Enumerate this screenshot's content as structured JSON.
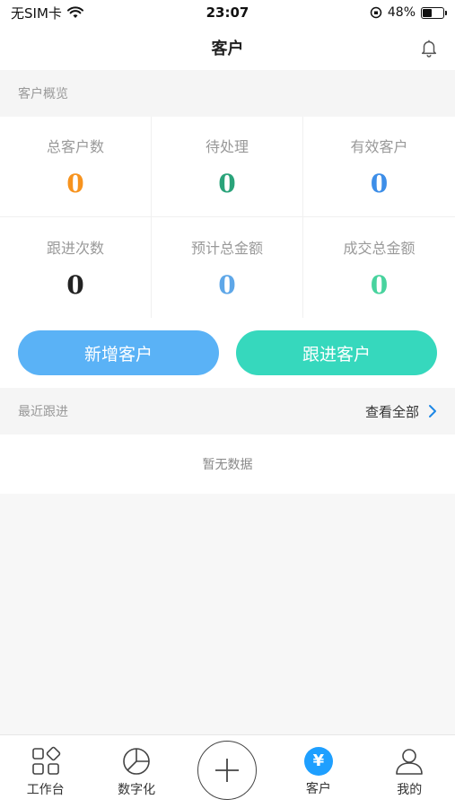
{
  "status": {
    "carrier": "无SIM卡",
    "time": "23:07",
    "battery_percent": "48%",
    "battery_level": 0.48
  },
  "nav": {
    "title": "客户",
    "bell_icon": "bell-icon"
  },
  "overview": {
    "title": "客户概览"
  },
  "stats": [
    {
      "label": "总客户数",
      "value": "0",
      "color": "#f7931e"
    },
    {
      "label": "待处理",
      "value": "0",
      "color": "#2aa37a"
    },
    {
      "label": "有效客户",
      "value": "0",
      "color": "#3d8ee8"
    },
    {
      "label": "跟进次数",
      "value": "0",
      "color": "#222222"
    },
    {
      "label": "预计总金额",
      "value": "0",
      "color": "#5ea7e8"
    },
    {
      "label": "成交总金额",
      "value": "0",
      "color": "#48d39e"
    }
  ],
  "buttons": {
    "add": "新增客户",
    "follow": "跟进客户"
  },
  "recent": {
    "title": "最近跟进",
    "view_all": "查看全部",
    "empty": "暂无数据"
  },
  "tabs": [
    {
      "label": "工作台",
      "icon": "grid-icon"
    },
    {
      "label": "数字化",
      "icon": "pie-chart-icon"
    },
    {
      "label": "",
      "icon": "plus-icon"
    },
    {
      "label": "客户",
      "icon": "yuan-icon",
      "active": true
    },
    {
      "label": "我的",
      "icon": "user-icon"
    }
  ],
  "colors": {
    "add_button": "#5ab2f6",
    "follow_button": "#36d8bd",
    "active_tab": "#1e9fff"
  }
}
